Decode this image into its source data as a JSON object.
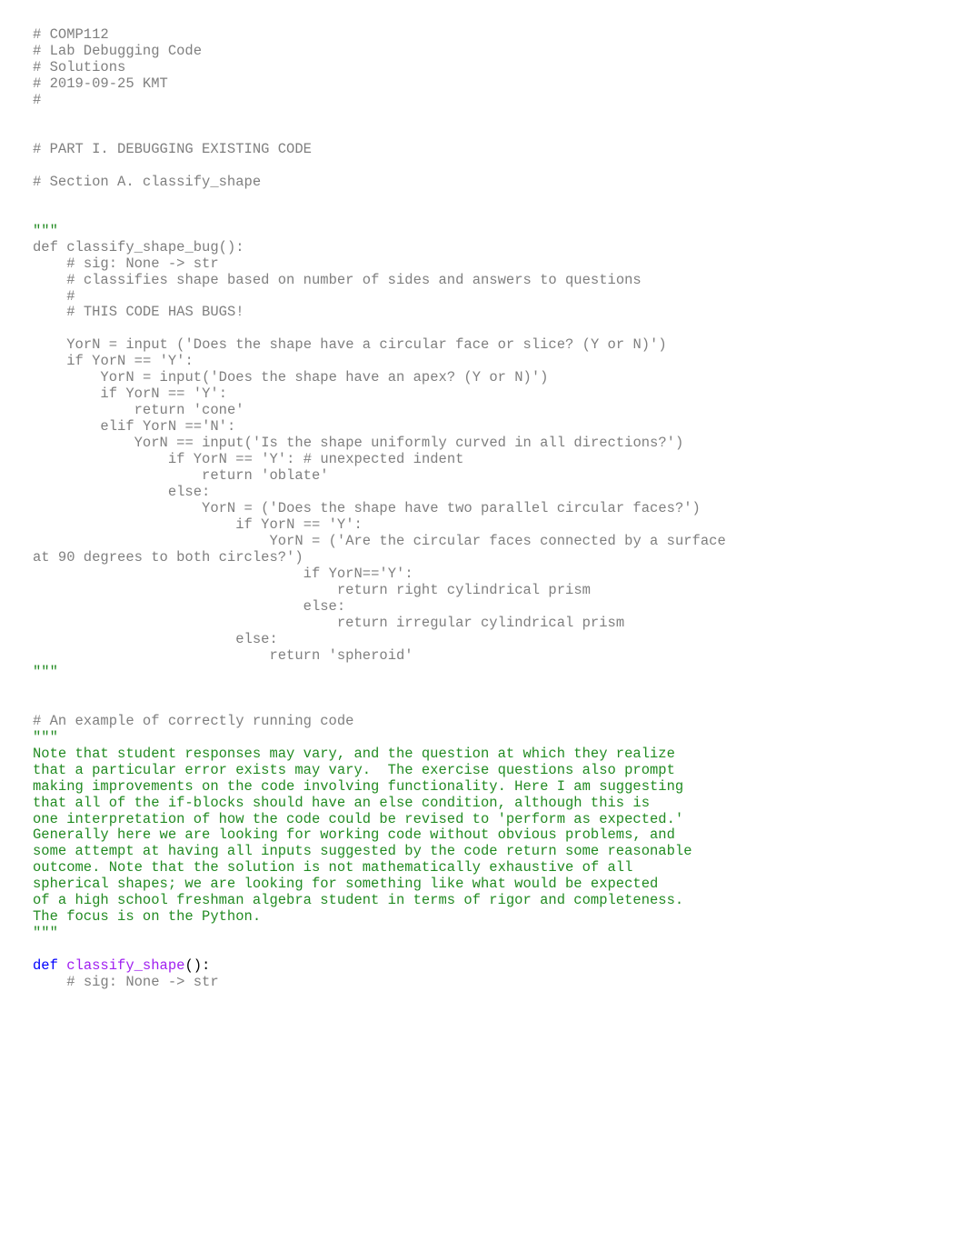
{
  "header_comments": [
    "# COMP112",
    "# Lab Debugging Code",
    "# Solutions",
    "# 2019-09-25 KMT",
    "#"
  ],
  "part_comments": [
    "# PART I. DEBUGGING EXISTING CODE",
    "# Section A. classify_shape"
  ],
  "triple_quote": "\"\"\"",
  "bug_fn_def_kw": "def",
  "bug_fn_name": "classify_shape_bug",
  "bug_fn_sig_suffix": "():",
  "bug_fn_comments": [
    "# sig: None -> str",
    "# classifies shape based on number of sides and answers to questions",
    "#",
    "# THIS CODE HAS BUGS!"
  ],
  "kw_if": "if",
  "kw_elif": "elif",
  "kw_else": "else",
  "kw_return": "return",
  "kw_def": "def",
  "id_YorN": "YorN",
  "id_input": "input",
  "eq": " == ",
  "assign": " = ",
  "dbl_eq": " == ",
  "colon": ":",
  "str_Y": "'Y'",
  "str_N": "'N'",
  "q_circular_face": "'Does the shape have a circular face or slice? (Y or N)'",
  "q_apex": "'Does the shape have an apex? (Y or N)'",
  "ret_cone": "'cone'",
  "q_uniform_curved": "'Is the shape uniformly curved in all directions?'",
  "cm_unexpected_indent": "# unexpected indent",
  "ret_oblate": "'oblate'",
  "q_two_parallel": "'Does the shape have two parallel circular faces?'",
  "q_surface_90_pre": "'Are the circular faces connected by a surface",
  "q_surface_90_cont": "at 90 degrees to both circles?'",
  "ret_right_cyl": "right cylindrical prism",
  "ret_irr_cyl": "irregular cylindrical prism",
  "ret_spheroid": "'spheroid'",
  "example_comment": "# An example of correctly running code",
  "note_lines": [
    "Note that student responses may vary, and the question at which they realize",
    "that a particular error exists may vary.  The exercise questions also prompt",
    "making improvements on the code involving functionality. Here I am suggesting",
    "that all of the if-blocks should have an else condition, although this is",
    "one interpretation of how the code could be revised to 'perform as expected.'",
    "Generally here we are looking for working code without obvious problems, and",
    "some attempt at having all inputs suggested by the code return some reasonable",
    "outcome. Note that the solution is not mathematically exhaustive of all",
    "spherical shapes; we are looking for something like what would be expected",
    "of a high school freshman algebra student in terms of rigor and completeness.",
    "The focus is on the Python."
  ],
  "fix_fn_name": "classify_shape",
  "fix_fn_comments": [
    "# sig: None -> str"
  ]
}
